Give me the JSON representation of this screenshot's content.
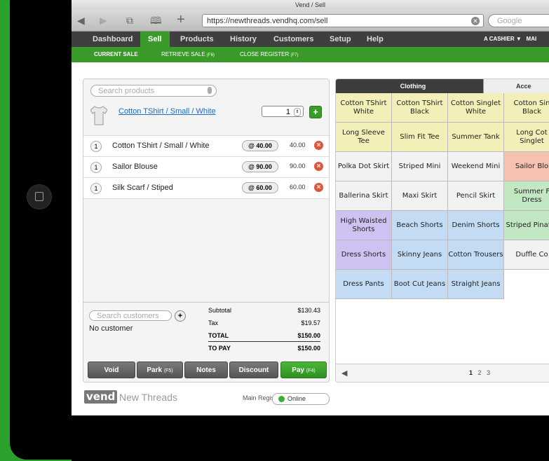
{
  "browser": {
    "window_title": "Vend / Sell",
    "url": "https://newthreads.vendhq.com/sell",
    "search_placeholder": "Google"
  },
  "nav": {
    "items": [
      "Dashboard",
      "Sell",
      "Products",
      "History",
      "Customers",
      "Setup",
      "Help"
    ],
    "active": "Sell",
    "cashier": "A CASHIER ▼",
    "cashier_extra": "MAI"
  },
  "subnav": {
    "current_sale": "CURRENT SALE",
    "retrieve_sale": "RETRIEVE SALE",
    "retrieve_key": "(F6)",
    "close_register": "CLOSE REGISTER",
    "close_key": "(F7)"
  },
  "sale": {
    "product_search_placeholder": "Search products",
    "current_product": "Cotton TShirt / Small / White",
    "current_qty": "1",
    "lines": [
      {
        "qty": "1",
        "name": "Cotton TShirt / Small / White",
        "price": "@ 40.00",
        "total": "40.00"
      },
      {
        "qty": "1",
        "name": "Sailor Blouse",
        "price": "@ 90.00",
        "total": "90.00"
      },
      {
        "qty": "1",
        "name": "Silk Scarf / Stiped",
        "price": "@ 60.00",
        "total": "60.00"
      }
    ],
    "customer_search_placeholder": "Search customers",
    "no_customer": "No customer",
    "totals": {
      "subtotal_label": "Subtotal",
      "subtotal": "$130.43",
      "tax_label": "Tax",
      "tax": "$19.57",
      "total_label": "TOTAL",
      "total": "$150.00",
      "topay_label": "TO PAY",
      "topay": "$150.00"
    },
    "actions": {
      "void": "Void",
      "park": "Park",
      "park_key": "(F5)",
      "notes": "Notes",
      "discount": "Discount",
      "pay": "Pay",
      "pay_key": "(F4)"
    }
  },
  "footer": {
    "logo": "vend",
    "store": "New Threads",
    "register": "Main Register",
    "status": "Online"
  },
  "quick_keys": {
    "tabs": [
      "Clothing",
      "Acce"
    ],
    "tiles": [
      [
        "Cotton TShirt White",
        "Cotton TShirt Black",
        "Cotton Singlet White",
        "Cotton Sin Black"
      ],
      [
        "Long Sleeve Tee",
        "Slim Fit Tee",
        "Summer Tank",
        "Long Cot Singlet"
      ],
      [
        "Polka Dot Skirt",
        "Striped Mini",
        "Weekend Mini",
        "Sailor Blo"
      ],
      [
        "Ballerina Skirt",
        "Maxi Skirt",
        "Pencil Skirt",
        "Summer F Dress"
      ],
      [
        "High Waisted Shorts",
        "Beach Shorts",
        "Denim Shorts",
        "Striped Pinafor"
      ],
      [
        "Dress Shorts",
        "Skinny Jeans",
        "Cotton Trousers",
        "Duffle Co"
      ],
      [
        "Dress Pants",
        "Boot Cut Jeans",
        "Straight Jeans"
      ]
    ],
    "tile_colors": [
      [
        "#f2efb8",
        "#f2efb8",
        "#f2efb8",
        "#f2efb8"
      ],
      [
        "#f2efb8",
        "#f2efb8",
        "#f2efb8",
        "#f2efb8"
      ],
      [
        "#f2f2f2",
        "#f2f2f2",
        "#f2f2f2",
        "#f6c1b0"
      ],
      [
        "#f2f2f2",
        "#f2f2f2",
        "#f2f2f2",
        "#c3e6c3"
      ],
      [
        "#cfc2f2",
        "#c3dcf4",
        "#c3dcf4",
        "#c3e6c3"
      ],
      [
        "#cfc2f2",
        "#c3dcf4",
        "#c3dcf4",
        "#f2f2f2"
      ],
      [
        "#c3dcf4",
        "#c3dcf4",
        "#c3dcf4"
      ]
    ],
    "pages": [
      "1",
      "2",
      "3"
    ],
    "current_page": "1"
  },
  "colors": {
    "accent": "#3a9a2a",
    "nav_bg": "#3f3f3f",
    "remove": "#e0553d"
  }
}
